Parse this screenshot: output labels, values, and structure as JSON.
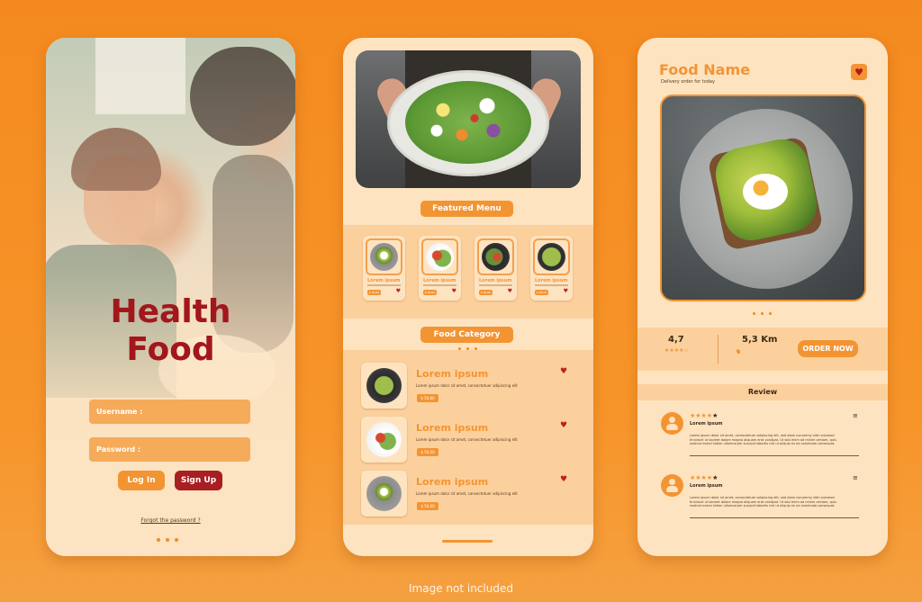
{
  "screen1": {
    "title_line1": "Health",
    "title_line2": "Food",
    "username_label": "Username :",
    "password_label": "Password :",
    "login_label": "Log In",
    "signup_label": "Sign Up",
    "forgot_label": "Forgot the password ?"
  },
  "screen2": {
    "featured_title": "Featured Menu",
    "featured_items": [
      {
        "title": "Lorem ipsum",
        "price": "$ 50,00",
        "icon": "heart-icon"
      },
      {
        "title": "Lorem ipsum",
        "price": "$ 50,00",
        "icon": "heart-icon"
      },
      {
        "title": "Lorem ipsum",
        "price": "$ 50,00",
        "icon": "heart-icon"
      },
      {
        "title": "Lorem ipsum",
        "price": "$ 50,00",
        "icon": "heart-icon"
      }
    ],
    "category_title": "Food Category",
    "category_items": [
      {
        "title": "Lorem ipsum",
        "desc": "Lorem ipsum dolor sit amet, consectetuer adipiscing elit",
        "price": "$ 50,00"
      },
      {
        "title": "Lorem ipsum",
        "desc": "Lorem ipsum dolor sit amet, consectetuer adipiscing elit",
        "price": "$ 50,00"
      },
      {
        "title": "Lorem ipsum",
        "desc": "Lorem ipsum dolor sit amet, consectetuer adipiscing elit",
        "price": "$ 50,00"
      }
    ]
  },
  "screen3": {
    "food_name": "Food Name",
    "subtitle": "Delivery order for today",
    "rating": "4,7",
    "distance": "5,3 Km",
    "order_label": "ORDER NOW",
    "review_title": "Review",
    "reviews": [
      {
        "name": "Lorem ipsum",
        "rating": 4,
        "text": "Lorem ipsum dolor sit amet, consectetuer adipiscing elit, sed diam nonummy nibh euismod tincidunt ut laoreet dolore magna aliquam erat volutpat. Ut wisi enim ad minim veniam, quis nostrud exerci tation ullamcorper suscipit lobortis nisl ut aliquip ex ea commodo consequat."
      },
      {
        "name": "Lorem ipsum",
        "rating": 4,
        "text": "Lorem ipsum dolor sit amet, consectetuer adipiscing elit, sed diam nonummy nibh euismod tincidunt ut laoreet dolore magna aliquam erat volutpat. Ut wisi enim ad minim veniam, quis nostrud exerci tation ullamcorper suscipit lobortis nisl ut aliquip ex ea commodo consequat."
      }
    ]
  },
  "footer_note": "Image not included",
  "colors": {
    "background": "#f48a1f",
    "screen": "#fde3c0",
    "band": "#fcd09c",
    "accent": "#f39433",
    "title_red": "#a3161c",
    "heart": "#c21f24"
  }
}
